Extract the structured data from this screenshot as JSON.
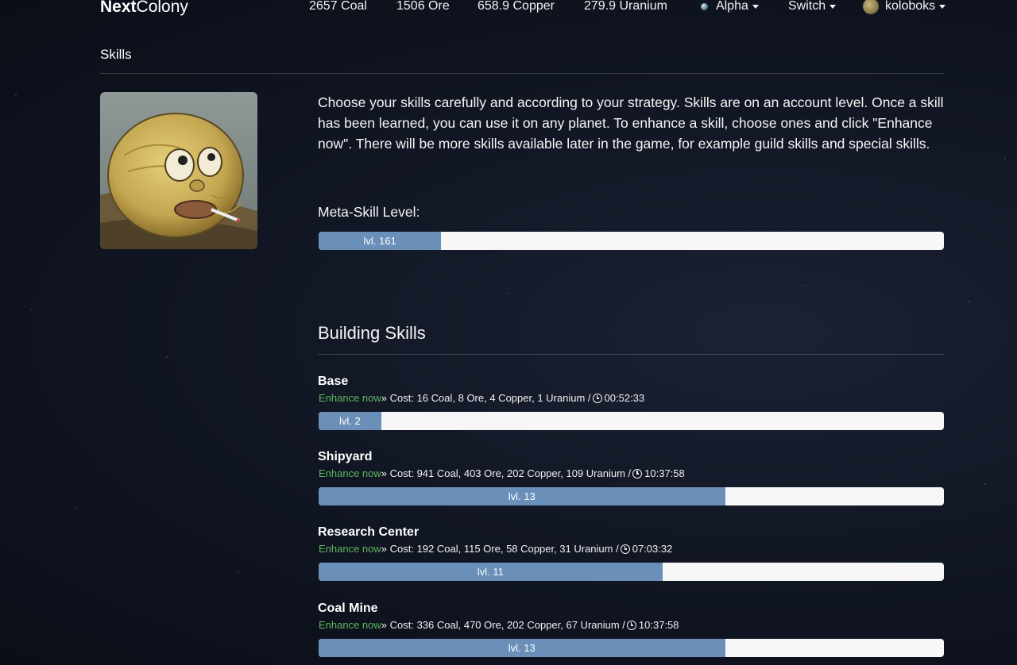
{
  "nav": {
    "brand_bold": "Next",
    "brand_light": "Colony",
    "resources": [
      "2657 Coal",
      "1506 Ore",
      "658.9 Copper",
      "279.9 Uranium"
    ],
    "planet_label": "Alpha",
    "switch_label": "Switch",
    "user_label": "koloboks"
  },
  "page": {
    "title": "Skills",
    "intro": "Choose your skills carefully and according to your strategy. Skills are on an account level. Once a skill has been learned, you can use it on any planet. To enhance a skill, choose ones and click \"Enhance now\". There will be more skills available later in the game, for example guild skills and special skills.",
    "meta_label": "Meta-Skill Level:",
    "meta_bar": {
      "label": "lvl. 161",
      "fraction": 0.196
    },
    "section_title": "Building Skills"
  },
  "skills": [
    {
      "name": "Base",
      "enhance_label": "Enhance now",
      "cost": " » Cost: 16 Coal, 8 Ore, 4 Copper, 1 Uranium / ",
      "time": "00:52:33",
      "level_label": "lvl. 2",
      "fraction": 0.1
    },
    {
      "name": "Shipyard",
      "enhance_label": "Enhance now",
      "cost": " » Cost: 941 Coal, 403 Ore, 202 Copper, 109 Uranium / ",
      "time": "10:37:58",
      "level_label": "lvl. 13",
      "fraction": 0.65
    },
    {
      "name": "Research Center",
      "enhance_label": "Enhance now",
      "cost": " » Cost: 192 Coal, 115 Ore, 58 Copper, 31 Uranium / ",
      "time": "07:03:32",
      "level_label": "lvl. 11",
      "fraction": 0.55
    },
    {
      "name": "Coal Mine",
      "enhance_label": "Enhance now",
      "cost": " » Cost: 336 Coal, 470 Ore, 202 Copper, 67 Uranium / ",
      "time": "10:37:58",
      "level_label": "lvl. 13",
      "fraction": 0.65
    }
  ],
  "colors": {
    "accent_bar": "#6a8fb8",
    "enhance_link": "#5cb85c",
    "background": "#121725"
  }
}
